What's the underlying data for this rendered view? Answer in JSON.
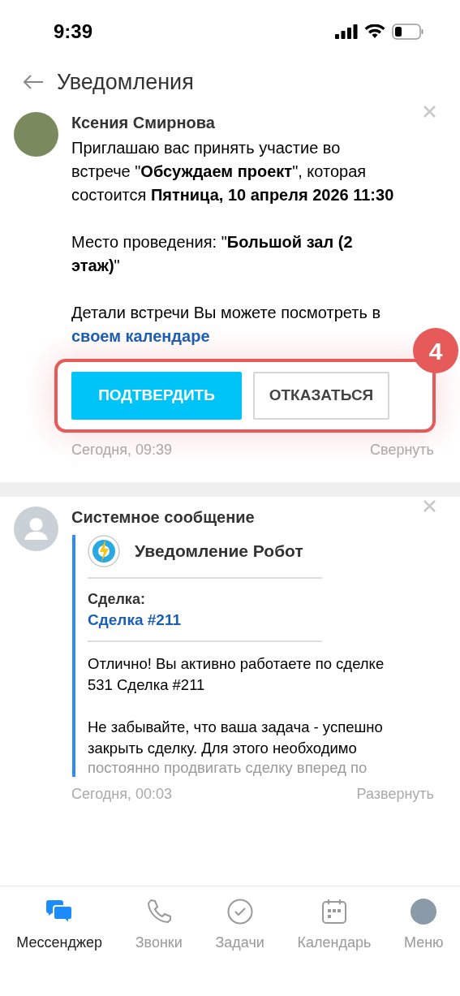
{
  "status_bar": {
    "time": "9:39"
  },
  "header": {
    "title": "Уведомления"
  },
  "notifications": [
    {
      "kind": "invite",
      "sender": "Ксения Смирнова",
      "paragraphs": [
        "Приглашаю вас принять участие во встрече \"**Обсуждаем проект**\", которая состоится **Пятница, 10 апреля 2026 11:30**",
        "Место проведения: \"**Большой зал (2 этаж)**\""
      ],
      "details": {
        "text": "Детали встречи Вы можете посмотреть в",
        "link": "своем календаре"
      },
      "buttons": [
        {
          "label": "ПОДТВЕРДИТЬ",
          "kind": "primary"
        },
        {
          "label": "ОТКАЗАТЬСЯ",
          "kind": "secondary"
        }
      ],
      "highlight": {
        "badge": "4"
      },
      "time": "Сегодня, 09:39",
      "toggle": "Свернуть"
    },
    {
      "kind": "system",
      "sender": "Системное сообщение",
      "card": {
        "title": "Уведомление Робот",
        "field_label": "Сделка:",
        "field_link": "Сделка #211",
        "paragraphs": [
          "Отлично! Вы активно работаете по сделке 531 Сделка #211",
          "Не забывайте, что ваша задача - успешно закрыть сделку. Для этого необходимо"
        ],
        "faded_line": "постоянно продвигать сделку вперед по"
      },
      "time": "Сегодня, 00:03",
      "toggle": "Развернуть"
    }
  ],
  "tab_bar": [
    {
      "label": "Мессенджер",
      "selected": true
    },
    {
      "label": "Звонки",
      "selected": false
    },
    {
      "label": "Задачи",
      "selected": false
    },
    {
      "label": "Календарь",
      "selected": false
    },
    {
      "label": "Меню",
      "selected": false
    }
  ]
}
